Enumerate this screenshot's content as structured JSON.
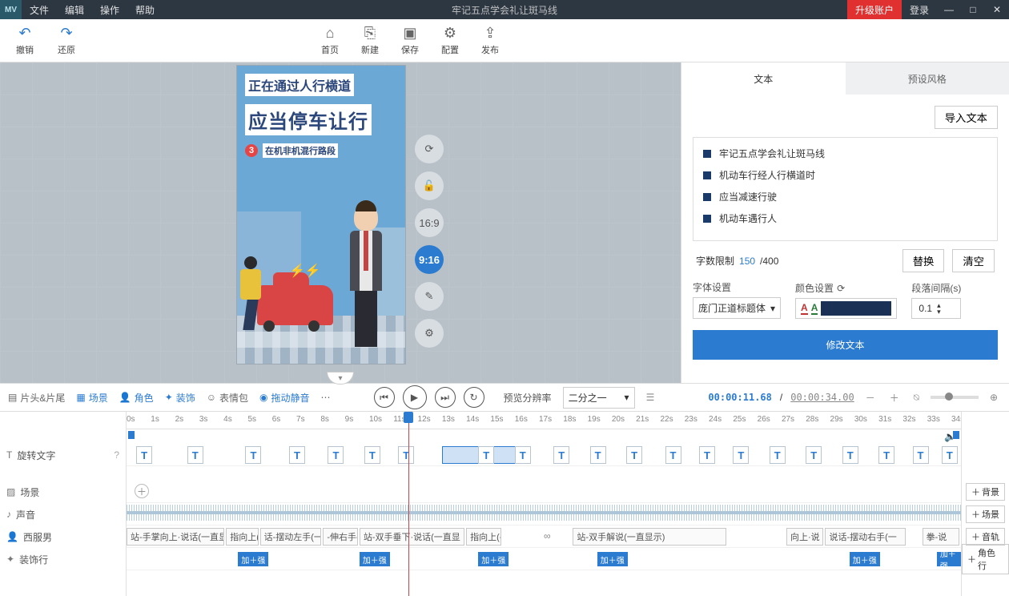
{
  "menubar": {
    "logo": "MV",
    "items": [
      "文件",
      "编辑",
      "操作",
      "帮助"
    ],
    "title": "牢记五点学会礼让斑马线",
    "upgrade": "升级账户",
    "login": "登录"
  },
  "toolbar": {
    "undo": "撤销",
    "redo": "还原",
    "home": "首页",
    "new": "新建",
    "save": "保存",
    "config": "配置",
    "publish": "发布"
  },
  "stage": {
    "headline1": "正在通过人行横道",
    "headline2": "应当停车让行",
    "badge": "3",
    "subtext": "在机非机混行路段",
    "ratio1": "16:9",
    "ratio2": "9:16"
  },
  "rpanel": {
    "tab_text": "文本",
    "tab_preset": "预设风格",
    "import": "导入文本",
    "lines": [
      "牢记五点学会礼让斑马线",
      "机动车行经人行横道时",
      "应当减速行驶",
      "机动车遇行人"
    ],
    "limit_label": "字数限制",
    "limit_cur": "150",
    "limit_sep": " /400",
    "replace": "替换",
    "clear": "清空",
    "font_label": "字体设置",
    "font_value": "庞门正道标题体",
    "color_label": "颜色设置",
    "gap_label": "段落间隔(s)",
    "gap_value": "0.1",
    "modify": "修改文本"
  },
  "tltool": {
    "head_tail": "片头&片尾",
    "scene": "场景",
    "role": "角色",
    "decor": "装饰",
    "emoji": "表情包",
    "mute": "拖动静音",
    "preview_label": "预览分辨率",
    "preview_value": "二分之一",
    "time_current": "00:00:11.68",
    "time_sep": " / ",
    "time_total": "00:00:34.00"
  },
  "tracks": {
    "ruler_max": 34,
    "text_track": "旋转文字",
    "scene_track": "场景",
    "sound_track": "声音",
    "char_track": "西服男",
    "decor_track": "装饰行",
    "add_bg": "背景",
    "add_scene": "场景",
    "add_audio": "音轨",
    "add_role": "角色行",
    "clips": [
      "站-手掌向上·说话(一直显",
      "指向上(-",
      "话-摆动左手(一",
      "-伸右手-",
      "站-双手垂下·说话(一直显",
      "指向上(-",
      "站-双手解说(一直显示)",
      "向上·说",
      "说话-摆动右手(一",
      "拳-说"
    ],
    "zhu_label": "加＋强"
  }
}
